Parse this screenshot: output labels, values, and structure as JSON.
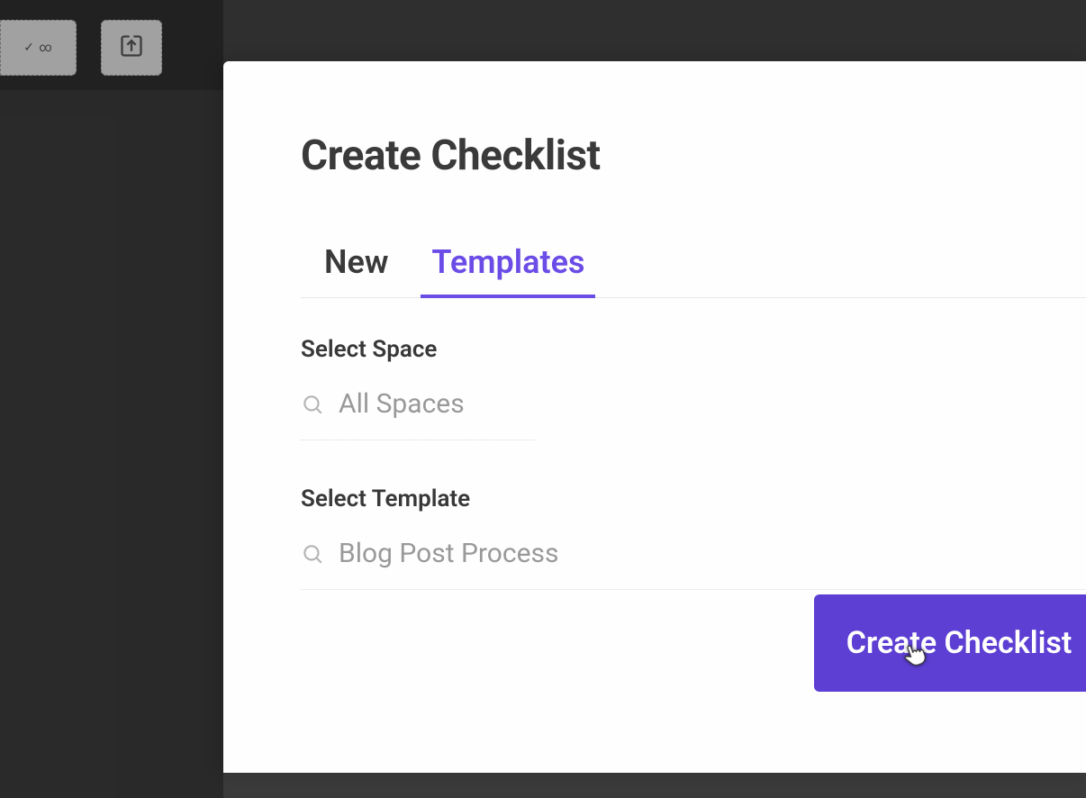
{
  "toolbar": {
    "icon1_symbol": "✓ ∞",
    "icon2_symbol": ""
  },
  "modal": {
    "title": "Create Checklist",
    "tabs": {
      "new": "New",
      "templates": "Templates"
    },
    "selectSpace": {
      "label": "Select Space",
      "value": "All Spaces"
    },
    "selectTemplate": {
      "label": "Select Template",
      "value": "Blog Post Process"
    },
    "createButton": "Create Checklist"
  },
  "colors": {
    "accent": "#5d3fd3",
    "tabActive": "#6b4ce6"
  }
}
